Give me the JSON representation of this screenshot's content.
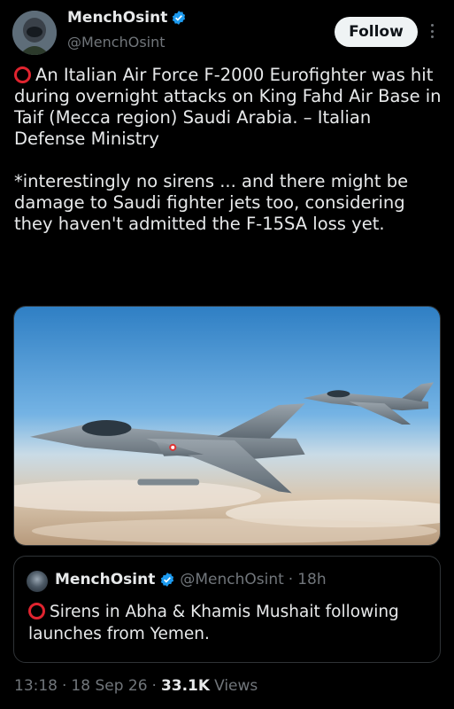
{
  "author": {
    "display_name": "MenchOsint",
    "handle": "@MenchOsint",
    "verified": true
  },
  "follow_label": "Follow",
  "tweet": {
    "emoji": "red-circle",
    "text": "An Italian Air Force F-2000 Eurofighter was hit during overnight attacks on King Fahd Air Base in Taif (Mecca region) Saudi Arabia. – Italian Defense Ministry\n\n*interestingly no sirens ... and there might be damage to Saudi fighter jets too, considering they haven't admitted the F-15SA loss yet."
  },
  "media": {
    "description_icon": "fighter-jets-photo"
  },
  "quote": {
    "display_name": "MenchOsint",
    "handle": "@MenchOsint",
    "separator": "·",
    "time": "18h",
    "text": "Sirens in Abha & Khamis Mushait following launches from Yemen."
  },
  "meta": {
    "time": "13:18",
    "dot1": "·",
    "date": "18 Sep 26",
    "dot2": "·",
    "views_count": "33.1K",
    "views_label": "Views"
  },
  "colors": {
    "background": "#000000",
    "text": "#e7e9ea",
    "muted": "#71767b",
    "verified": "#1d9bf0",
    "emoji_red": "#e0242f"
  }
}
